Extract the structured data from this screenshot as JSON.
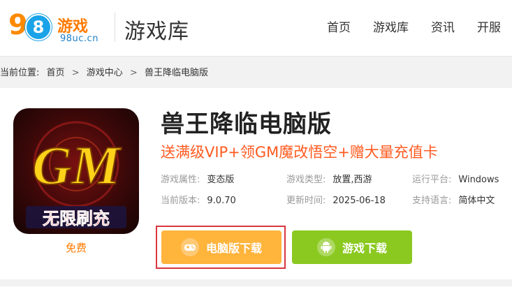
{
  "header": {
    "logo_cn": "游戏",
    "logo_domain": "98uc.cn",
    "title": "游戏库",
    "nav": [
      "首页",
      "游戏库",
      "资讯",
      "开服"
    ]
  },
  "breadcrumb": {
    "prefix": "当前位置:",
    "items": [
      "首页",
      "游戏中心",
      "兽王降临电脑版"
    ],
    "separator": ">"
  },
  "game": {
    "title": "兽王降临电脑版",
    "promo": "送满级VIP+领GM魔改悟空+赠大量充值卡",
    "icon_text_top": "GM",
    "icon_text_bottom": "无限刷充",
    "price_label": "免费",
    "attributes": [
      [
        {
          "key": "游戏属性:",
          "value": "变态版"
        },
        {
          "key": "游戏类型:",
          "value": "放置,西游"
        },
        {
          "key": "运行平台:",
          "value": "Windows"
        }
      ],
      [
        {
          "key": "当前版本:",
          "value": "9.0.70"
        },
        {
          "key": "更新时间:",
          "value": "2025-06-18"
        },
        {
          "key": "支持语言:",
          "value": "简体中文"
        }
      ]
    ]
  },
  "buttons": {
    "pc_download": "电脑版下载",
    "game_download": "游戏下载"
  },
  "colors": {
    "brand_orange": "#ff7a00",
    "promo_red": "#ff5a1f",
    "pc_button": "#ffb43c",
    "game_button": "#8bc920",
    "highlight": "#d9363e"
  }
}
